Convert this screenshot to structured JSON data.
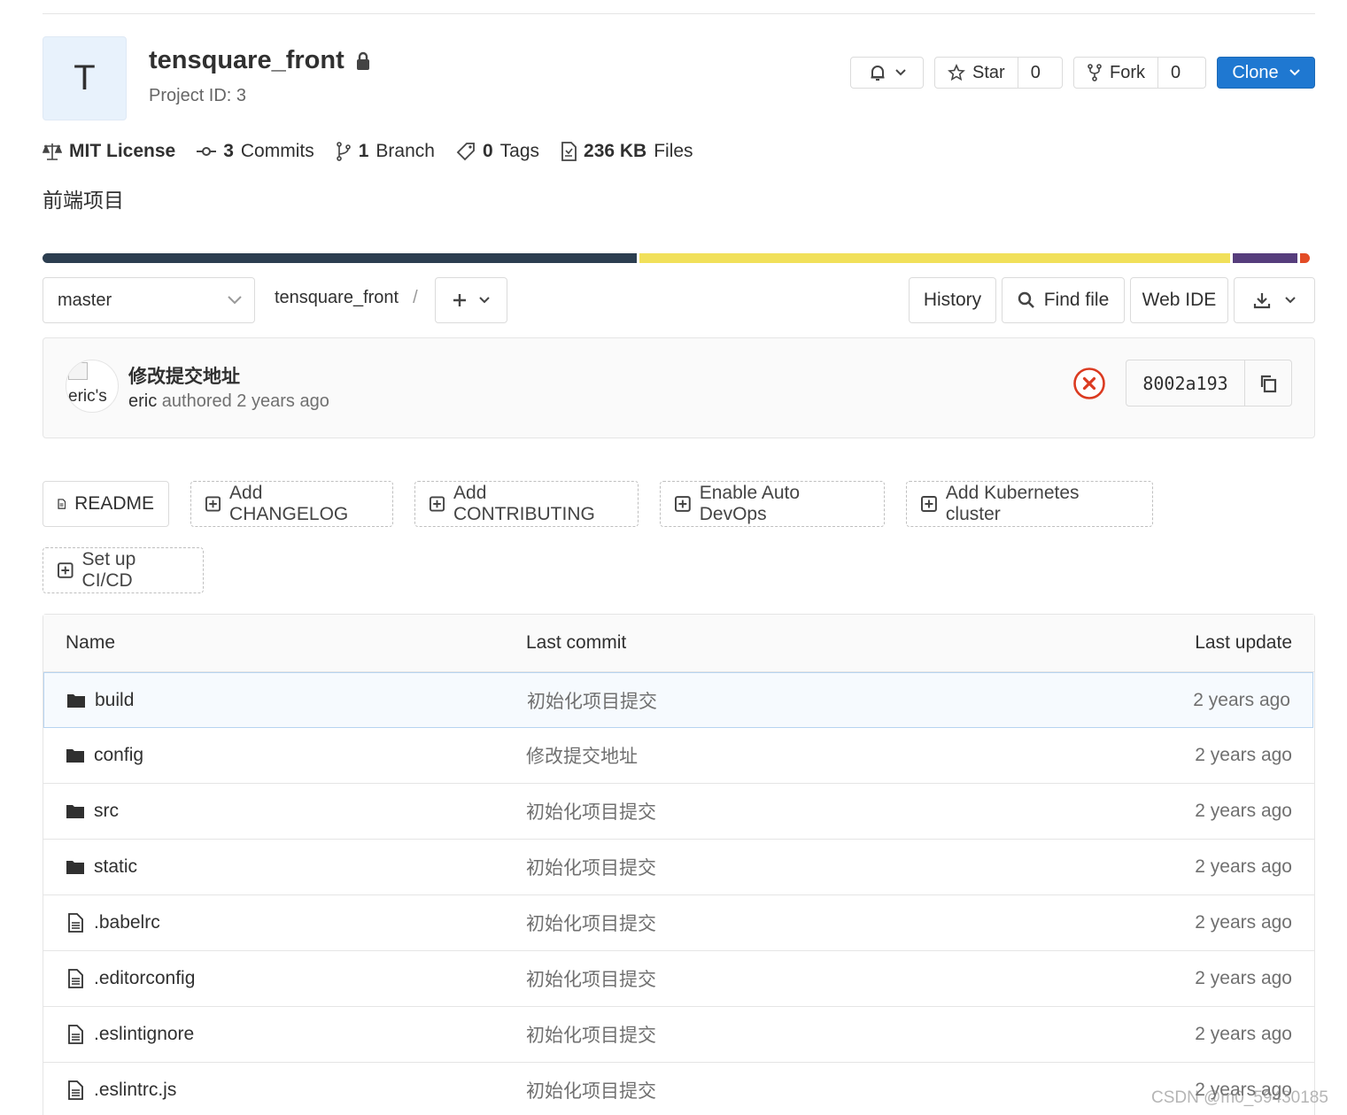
{
  "project": {
    "avatar_letter": "T",
    "title": "tensquare_front",
    "project_id": "Project ID: 3",
    "description": "前端项目"
  },
  "header_buttons": {
    "star_label": "Star",
    "star_count": "0",
    "fork_label": "Fork",
    "fork_count": "0",
    "clone_label": "Clone"
  },
  "stats": {
    "license": "MIT License",
    "commits_count": "3",
    "commits_label": "Commits",
    "branch_count": "1",
    "branch_label": "Branch",
    "tags_count": "0",
    "tags_label": "Tags",
    "files_size": "236 KB",
    "files_label": "Files"
  },
  "languages": [
    {
      "color": "#2c3e50",
      "fraction": 0.47
    },
    {
      "color": "#f1e05a",
      "fraction": 0.467
    },
    {
      "color": "#563d7c",
      "fraction": 0.051
    },
    {
      "color": "#e34c26",
      "fraction": 0.008
    }
  ],
  "nav": {
    "branch": "master",
    "breadcrumb_root": "tensquare_front",
    "breadcrumb_sep": "/",
    "history": "History",
    "find_file": "Find file",
    "web_ide": "Web IDE"
  },
  "commit": {
    "avatar_alt": "eric's",
    "title": "修改提交地址",
    "author": "eric",
    "authored_text": "authored 2 years ago",
    "sha": "8002a193",
    "status_color": "#db3b21"
  },
  "suggestions": {
    "readme": "README",
    "changelog": "Add CHANGELOG",
    "contributing": "Add CONTRIBUTING",
    "devops": "Enable Auto DevOps",
    "k8s": "Add Kubernetes cluster",
    "cicd": "Set up CI/CD"
  },
  "table": {
    "headers": {
      "name": "Name",
      "last_commit": "Last commit",
      "last_update": "Last update"
    },
    "rows": [
      {
        "type": "folder",
        "name": "build",
        "commit": "初始化项目提交",
        "updated": "2 years ago"
      },
      {
        "type": "folder",
        "name": "config",
        "commit": "修改提交地址",
        "updated": "2 years ago"
      },
      {
        "type": "folder",
        "name": "src",
        "commit": "初始化项目提交",
        "updated": "2 years ago"
      },
      {
        "type": "folder",
        "name": "static",
        "commit": "初始化项目提交",
        "updated": "2 years ago"
      },
      {
        "type": "file",
        "name": ".babelrc",
        "commit": "初始化项目提交",
        "updated": "2 years ago"
      },
      {
        "type": "file",
        "name": ".editorconfig",
        "commit": "初始化项目提交",
        "updated": "2 years ago"
      },
      {
        "type": "file",
        "name": ".eslintignore",
        "commit": "初始化项目提交",
        "updated": "2 years ago"
      },
      {
        "type": "file",
        "name": ".eslintrc.js",
        "commit": "初始化项目提交",
        "updated": "2 years ago"
      }
    ]
  },
  "watermark": "CSDN @m0_59430185"
}
